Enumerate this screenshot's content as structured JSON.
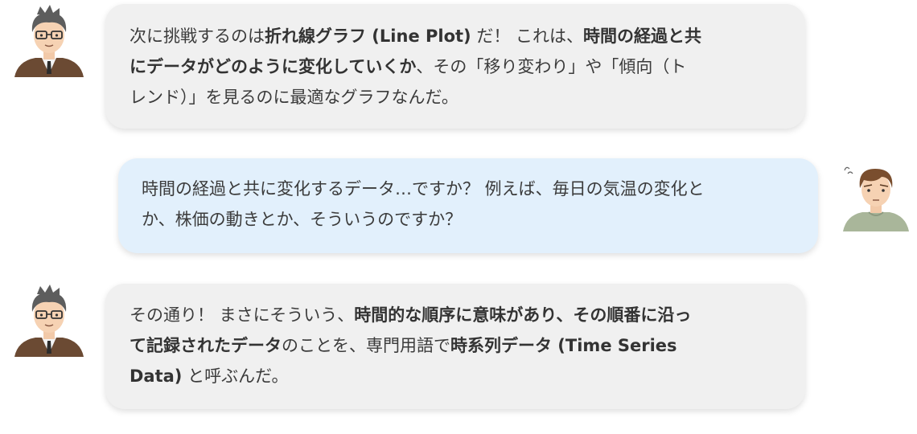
{
  "messages": [
    {
      "speaker": "teacher",
      "lines": [
        [
          {
            "t": "次に挑戦するのは",
            "b": false
          },
          {
            "t": "折れ線グラフ (Line Plot)",
            "b": true
          },
          {
            "t": " だ！ これは、",
            "b": false
          },
          {
            "t": "時間の経過と共",
            "b": true
          }
        ],
        [
          {
            "t": "にデータがどのように変化していくか",
            "b": true
          },
          {
            "t": "、その「移り変わり」や「傾向（ト",
            "b": false
          }
        ],
        [
          {
            "t": "レンド）」を見るのに最適なグラフなんだ。",
            "b": false
          }
        ]
      ]
    },
    {
      "speaker": "student",
      "lines": [
        [
          {
            "t": "時間の経過と共に変化するデータ…ですか？ 例えば、毎日の気温の変化と",
            "b": false
          }
        ],
        [
          {
            "t": "か、株価の動きとか、そういうのですか？",
            "b": false
          }
        ]
      ]
    },
    {
      "speaker": "teacher",
      "lines": [
        [
          {
            "t": "その通り！ まさにそういう、",
            "b": false
          },
          {
            "t": "時間的な順序に意味があり、その順番に沿っ",
            "b": true
          }
        ],
        [
          {
            "t": "て記録されたデータ",
            "b": true
          },
          {
            "t": "のことを、専門用語で",
            "b": false
          },
          {
            "t": "時系列データ (Time Series",
            "b": true
          }
        ],
        [
          {
            "t": "Data)",
            "b": true
          },
          {
            "t": " と呼ぶんだ。",
            "b": false
          }
        ]
      ]
    }
  ],
  "colors": {
    "teacher_bubble": "#f0f0f0",
    "student_bubble": "#e2f0fc",
    "text": "#3b3b3b"
  },
  "icons": {
    "teacher": "teacher-avatar-icon",
    "student": "student-avatar-icon"
  }
}
